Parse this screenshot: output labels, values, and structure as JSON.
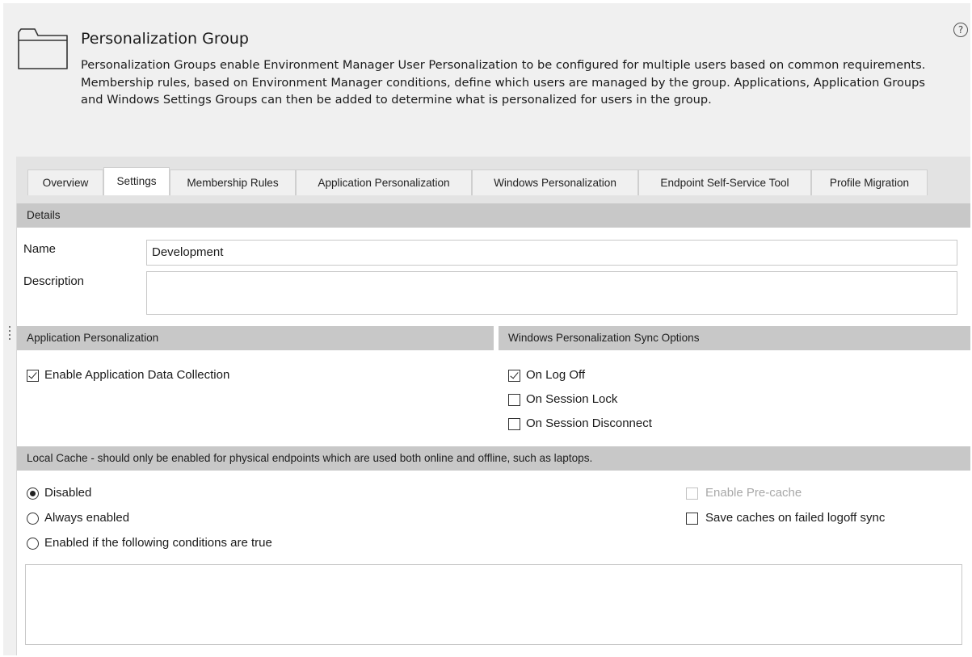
{
  "header": {
    "title": "Personalization Group",
    "description": "Personalization Groups enable Environment Manager User Personalization to be configured for multiple users based on common requirements. Membership rules, based on Environment Manager conditions, define which users are managed by the group. Applications, Application Groups and Windows Settings Groups can then be added to determine what is personalized for users in the group.",
    "icon": "folder-icon",
    "help_glyph": "?"
  },
  "tabs": [
    {
      "label": "Overview",
      "active": false
    },
    {
      "label": "Settings",
      "active": true
    },
    {
      "label": "Membership Rules",
      "active": false
    },
    {
      "label": "Application Personalization",
      "active": false
    },
    {
      "label": "Windows Personalization",
      "active": false
    },
    {
      "label": "Endpoint Self-Service Tool",
      "active": false
    },
    {
      "label": "Profile Migration",
      "active": false
    }
  ],
  "details": {
    "section_title": "Details",
    "name_label": "Name",
    "name_value": "Development",
    "description_label": "Description",
    "description_value": ""
  },
  "app_personalization": {
    "section_title": "Application Personalization",
    "enable_data_collection": {
      "label": "Enable Application Data Collection",
      "checked": true
    }
  },
  "windows_sync": {
    "section_title": "Windows Personalization Sync Options",
    "options": [
      {
        "label": "On Log Off",
        "checked": true
      },
      {
        "label": "On Session Lock",
        "checked": false
      },
      {
        "label": "On Session Disconnect",
        "checked": false
      }
    ]
  },
  "local_cache": {
    "section_title": "Local Cache - should only be enabled for physical endpoints which are used both online and offline, such as laptops.",
    "radios": [
      {
        "label": "Disabled",
        "selected": true
      },
      {
        "label": "Always enabled",
        "selected": false
      },
      {
        "label": "Enabled if the following conditions are true",
        "selected": false
      }
    ],
    "enable_precache": {
      "label": "Enable Pre-cache",
      "checked": false,
      "disabled": true
    },
    "save_caches": {
      "label": "Save caches on failed logoff sync",
      "checked": false
    }
  },
  "colors": {
    "background": "#f0f0f0",
    "section_header": "#c8c8c8",
    "panel": "#ffffff",
    "disabled_text": "#a8a8a8"
  }
}
